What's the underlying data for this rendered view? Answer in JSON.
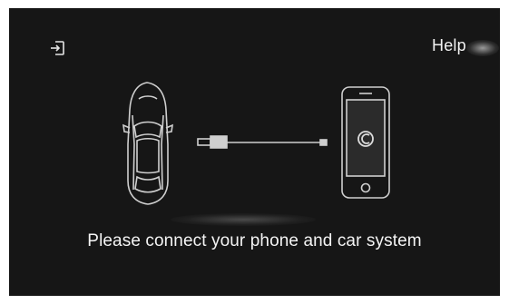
{
  "header": {
    "help_label": "Help",
    "exit_icon": "exit-icon"
  },
  "illustration": {
    "car_icon": "car-top-view-icon",
    "cable_icon": "usb-cable-icon",
    "phone_icon": "smartphone-icon",
    "app_logo_icon": "carplay-logo-icon"
  },
  "main": {
    "message": "Please connect your phone and car system"
  },
  "colors": {
    "background": "#161616",
    "outline": "#cfcfcf",
    "text": "#f4f4f4"
  }
}
